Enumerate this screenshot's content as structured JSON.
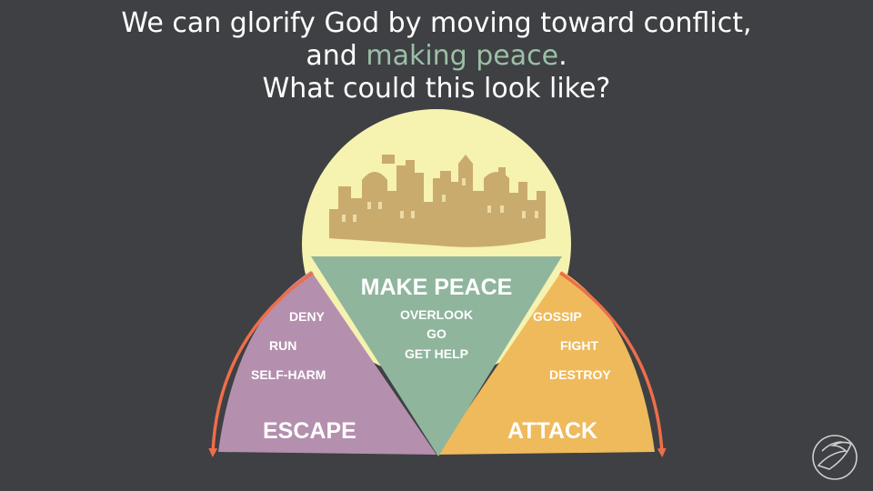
{
  "title": {
    "line1": "We can glorify God by moving toward conflict,",
    "line2_prefix": "and ",
    "line2_highlight": "making peace",
    "line2_suffix": ".",
    "line3": "What could this look like?"
  },
  "colors": {
    "background": "#3e4044",
    "highlight": "#9cbfa5",
    "sun": "#f6f2b0",
    "escape": "#b48fae",
    "peace": "#8fb59d",
    "attack": "#eeba5c",
    "arrow": "#ee6e4a",
    "city": "#c9ab6e"
  },
  "diagram": {
    "peace": {
      "heading": "MAKE PEACE",
      "items": [
        "OVERLOOK",
        "GO",
        "GET HELP"
      ]
    },
    "escape": {
      "heading": "ESCAPE",
      "items": [
        "DENY",
        "RUN",
        "SELF-HARM"
      ]
    },
    "attack": {
      "heading": "ATTACK",
      "items": [
        "GOSSIP",
        "FIGHT",
        "DESTROY"
      ]
    }
  },
  "icons": {
    "city": "city-skyline-icon",
    "logo": "dove-logo-icon"
  }
}
